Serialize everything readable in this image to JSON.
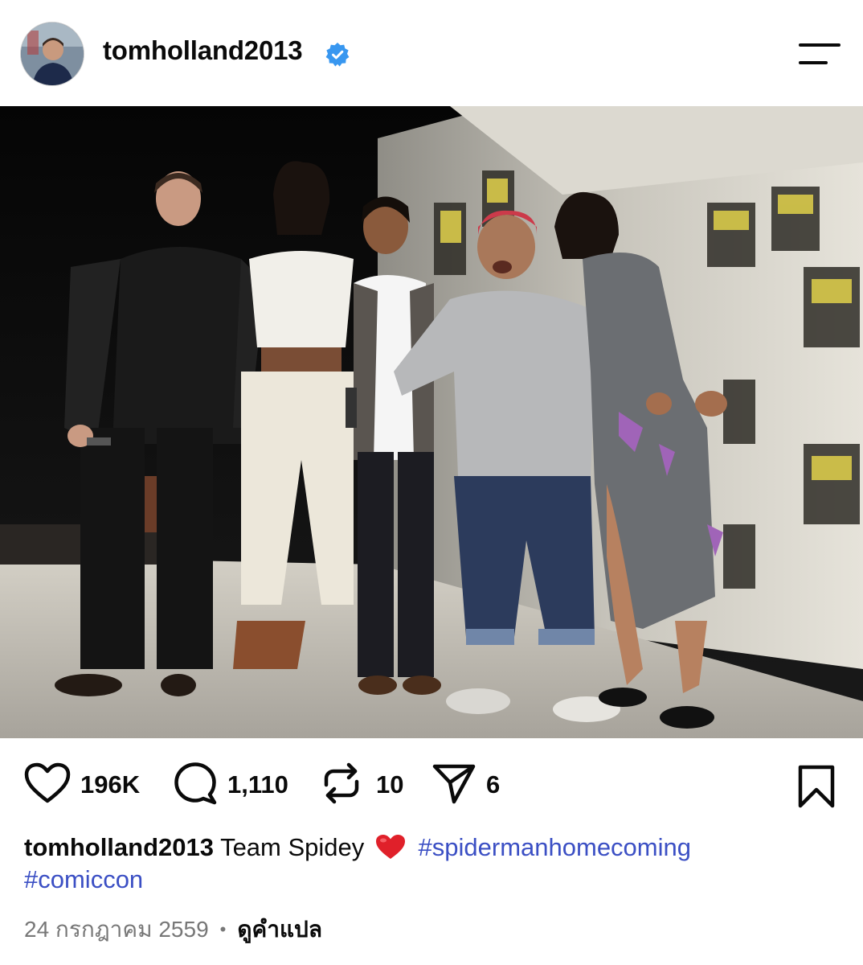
{
  "post": {
    "username": "tomholland2013",
    "verified": true,
    "likes": "196K",
    "comments": "1,110",
    "reposts": "10",
    "shares": "6",
    "caption": {
      "username": "tomholland2013",
      "text": "Team Spidey",
      "hashtags": [
        "#spidermanhomecoming",
        "#comiccon"
      ]
    },
    "date": "24 กรกฎาคม 2559",
    "translate_label": "ดูคำแปล"
  },
  "icons": {
    "menu": "menu-icon",
    "like": "heart-icon",
    "comment": "comment-icon",
    "repost": "repost-icon",
    "share": "paper-plane-icon",
    "save": "bookmark-icon",
    "verified": "verified-badge-icon"
  },
  "colors": {
    "verified_blue": "#3897f0",
    "hashtag": "#3b4fc4",
    "meta_gray": "#777777",
    "emoji_red": "#e0202a"
  }
}
